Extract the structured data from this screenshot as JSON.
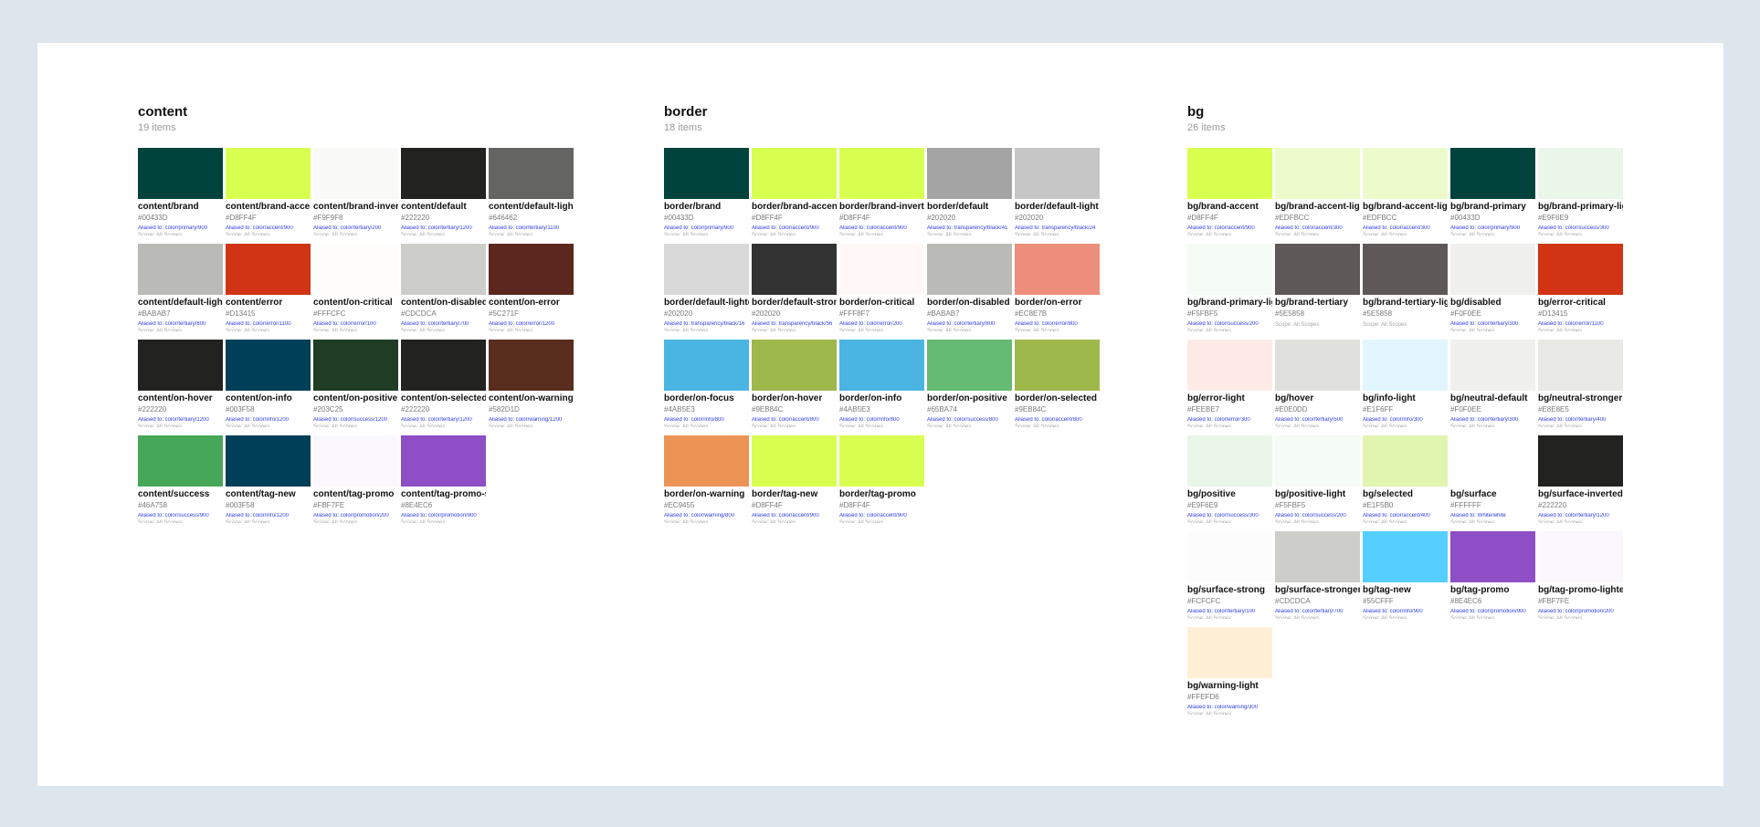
{
  "groups": [
    {
      "id": "content",
      "title": "content",
      "count": "19 items",
      "items": [
        {
          "name": "content/brand",
          "hex": "#00433D",
          "alias": "Aliased to: color/primary/900",
          "scope": "Scope: All Scopes",
          "color": "#00433D"
        },
        {
          "name": "content/brand-accent",
          "hex": "#D8FF4F",
          "alias": "Aliased to: color/accent/900",
          "scope": "Scope: All Scopes",
          "color": "#D8FF4F"
        },
        {
          "name": "content/brand-inverted",
          "hex": "#F9F9F8",
          "alias": "Aliased to: color/tertiary/200",
          "scope": "Scope: All Scopes",
          "color": "#F9F9F8"
        },
        {
          "name": "content/default",
          "hex": "#222220",
          "alias": "Aliased to: color/tertiary/1200",
          "scope": "Scope: All Scopes",
          "color": "#222220"
        },
        {
          "name": "content/default-light",
          "hex": "#646462",
          "alias": "Aliased to: color/tertiary/1100",
          "scope": "Scope: All Scopes",
          "color": "#646462"
        },
        {
          "name": "content/default-lighter",
          "hex": "#BABAB7",
          "alias": "Aliased to: color/tertiary/800",
          "scope": "Scope: All Scopes",
          "color": "#BABAB7"
        },
        {
          "name": "content/error",
          "hex": "#D13415",
          "alias": "Aliased to: color/error/1100",
          "scope": "Scope: All Scopes",
          "color": "#D13415"
        },
        {
          "name": "content/on-critical",
          "hex": "#FFFCFC",
          "alias": "Aliased to: color/error/100",
          "scope": "Scope: All Scopes",
          "color": "#FFFCFC"
        },
        {
          "name": "content/on-disabled",
          "hex": "#CDCDCA",
          "alias": "Aliased to: color/tertiary/700",
          "scope": "Scope: All Scopes",
          "color": "#CDCDCA"
        },
        {
          "name": "content/on-error",
          "hex": "#5C271F",
          "alias": "Aliased to: color/error/1200",
          "scope": "Scope: All Scopes",
          "color": "#5C271F"
        },
        {
          "name": "content/on-hover",
          "hex": "#222220",
          "alias": "Aliased to: color/tertiary/1200",
          "scope": "Scope: All Scopes",
          "color": "#222220"
        },
        {
          "name": "content/on-info",
          "hex": "#003F58",
          "alias": "Aliased to: color/info/1200",
          "scope": "Scope: All Scopes",
          "color": "#003F58"
        },
        {
          "name": "content/on-positive",
          "hex": "#203C25",
          "alias": "Aliased to: color/success/1200",
          "scope": "Scope: All Scopes",
          "color": "#203C25"
        },
        {
          "name": "content/on-selected",
          "hex": "#222220",
          "alias": "Aliased to: color/tertiary/1200",
          "scope": "Scope: All Scopes",
          "color": "#222220"
        },
        {
          "name": "content/on-warning",
          "hex": "#582D1D",
          "alias": "Aliased to: color/warning/1200",
          "scope": "Scope: All Scopes",
          "color": "#582D1D"
        },
        {
          "name": "content/success",
          "hex": "#46A758",
          "alias": "Aliased to: color/success/900",
          "scope": "Scope: All Scopes",
          "color": "#46A758"
        },
        {
          "name": "content/tag-new",
          "hex": "#003F58",
          "alias": "Aliased to: color/info/1200",
          "scope": "Scope: All Scopes",
          "color": "#003F58"
        },
        {
          "name": "content/tag-promo",
          "hex": "#FBF7FE",
          "alias": "Aliased to: color/promotion/200",
          "scope": "Scope: All Scopes",
          "color": "#FBF7FE"
        },
        {
          "name": "content/tag-promo-strong",
          "hex": "#8E4EC6",
          "alias": "Aliased to: color/promotion/900",
          "scope": "Scope: All Scopes",
          "color": "#8E4EC6"
        }
      ]
    },
    {
      "id": "border",
      "title": "border",
      "count": "18 items",
      "items": [
        {
          "name": "border/brand",
          "hex": "#00433D",
          "alias": "Aliased to: color/primary/900",
          "scope": "Scope: All Scopes",
          "color": "#00433D"
        },
        {
          "name": "border/brand-accent",
          "hex": "#D8FF4F",
          "alias": "Aliased to: color/accent/900",
          "scope": "Scope: All Scopes",
          "color": "#D8FF4F"
        },
        {
          "name": "border/brand-inverted",
          "hex": "#D8FF4F",
          "alias": "Aliased to: color/accent/900",
          "scope": "Scope: All Scopes",
          "color": "#D8FF4F"
        },
        {
          "name": "border/default",
          "hex": "#202020",
          "alias": "Aliased to: transparency/black/41",
          "scope": "Scope: All Scopes",
          "color": "#A4A4A4"
        },
        {
          "name": "border/default-light",
          "hex": "#202020",
          "alias": "Aliased to: transparency/black/24",
          "scope": "Scope: All Scopes",
          "color": "#C6C6C6"
        },
        {
          "name": "border/default-lighter",
          "hex": "#202020",
          "alias": "Aliased to: transparency/black/16",
          "scope": "Scope: All Scopes",
          "color": "#D9D9D9"
        },
        {
          "name": "border/default-strong",
          "hex": "#202020",
          "alias": "Aliased to: transparency/black/56",
          "scope": "Scope: All Scopes",
          "color": "#333333"
        },
        {
          "name": "border/on-critical",
          "hex": "#FFF8F7",
          "alias": "Aliased to: color/error/200",
          "scope": "Scope: All Scopes",
          "color": "#FFF8F7"
        },
        {
          "name": "border/on-disabled",
          "hex": "#BABAB7",
          "alias": "Aliased to: color/tertiary/800",
          "scope": "Scope: All Scopes",
          "color": "#BABAB7"
        },
        {
          "name": "border/on-error",
          "hex": "#EC8E7B",
          "alias": "Aliased to: color/error/800",
          "scope": "Scope: All Scopes",
          "color": "#EC8E7B"
        },
        {
          "name": "border/on-focus",
          "hex": "#4AB5E3",
          "alias": "Aliased to: color/info/800",
          "scope": "Scope: All Scopes",
          "color": "#4AB5E3"
        },
        {
          "name": "border/on-hover",
          "hex": "#9EB84C",
          "alias": "Aliased to: color/accent/800",
          "scope": "Scope: All Scopes",
          "color": "#9EB84C"
        },
        {
          "name": "border/on-info",
          "hex": "#4AB5E3",
          "alias": "Aliased to: color/info/800",
          "scope": "Scope: All Scopes",
          "color": "#4AB5E3"
        },
        {
          "name": "border/on-positive",
          "hex": "#65BA74",
          "alias": "Aliased to: color/success/800",
          "scope": "Scope: All Scopes",
          "color": "#65BA74"
        },
        {
          "name": "border/on-selected",
          "hex": "#9EB84C",
          "alias": "Aliased to: color/accent/800",
          "scope": "Scope: All Scopes",
          "color": "#9EB84C"
        },
        {
          "name": "border/on-warning",
          "hex": "#EC9455",
          "alias": "Aliased to: color/warning/800",
          "scope": "Scope: All Scopes",
          "color": "#EC9455"
        },
        {
          "name": "border/tag-new",
          "hex": "#D8FF4F",
          "alias": "Aliased to: color/accent/900",
          "scope": "Scope: All Scopes",
          "color": "#D8FF4F"
        },
        {
          "name": "border/tag-promo",
          "hex": "#D8FF4F",
          "alias": "Aliased to: color/accent/900",
          "scope": "Scope: All Scopes",
          "color": "#D8FF4F"
        }
      ]
    },
    {
      "id": "bg",
      "title": "bg",
      "count": "26 items",
      "items": [
        {
          "name": "bg/brand-accent",
          "hex": "#D8FF4F",
          "alias": "Aliased to: color/accent/900",
          "scope": "Scope: All Scopes",
          "color": "#D8FF4F"
        },
        {
          "name": "bg/brand-accent-light",
          "hex": "#EDFBCC",
          "alias": "Aliased to: color/accent/300",
          "scope": "Scope: All Scopes",
          "color": "#EDFBCC"
        },
        {
          "name": "bg/brand-accent-lighter",
          "hex": "#EDFBCC",
          "alias": "Aliased to: color/accent/300",
          "scope": "Scope: All Scopes",
          "color": "#EDFBCC"
        },
        {
          "name": "bg/brand-primary",
          "hex": "#00433D",
          "alias": "Aliased to: color/primary/900",
          "scope": "Scope: All Scopes",
          "color": "#00433D"
        },
        {
          "name": "bg/brand-primary-light",
          "hex": "#E9F6E9",
          "alias": "Aliased to: color/success/300",
          "scope": "Scope: All Scopes",
          "color": "#E9F6E9"
        },
        {
          "name": "bg/brand-primary-lighter",
          "hex": "#F5FBF5",
          "alias": "Aliased to: color/success/200",
          "scope": "Scope: All Scopes",
          "color": "#F5FBF5"
        },
        {
          "name": "bg/brand-tertiary",
          "hex": "#5E5858",
          "alias": "",
          "scope": "Scope: All Scopes",
          "color": "#5E5858"
        },
        {
          "name": "bg/brand-tertiary-light",
          "hex": "#5E5858",
          "alias": "",
          "scope": "Scope: All Scopes",
          "color": "#5E5858"
        },
        {
          "name": "bg/disabled",
          "hex": "#F0F0EE",
          "alias": "Aliased to: color/tertiary/300",
          "scope": "Scope: All Scopes",
          "color": "#F0F0EE"
        },
        {
          "name": "bg/error-critical",
          "hex": "#D13415",
          "alias": "Aliased to: color/error/1100",
          "scope": "Scope: All Scopes",
          "color": "#D13415"
        },
        {
          "name": "bg/error-light",
          "hex": "#FEEBE7",
          "alias": "Aliased to: color/error/300",
          "scope": "Scope: All Scopes",
          "color": "#FEEBE7"
        },
        {
          "name": "bg/hover",
          "hex": "#E0E0DD",
          "alias": "Aliased to: color/tertiary/500",
          "scope": "Scope: All Scopes",
          "color": "#E0E0DD"
        },
        {
          "name": "bg/info-light",
          "hex": "#E1F6FF",
          "alias": "Aliased to: color/info/300",
          "scope": "Scope: All Scopes",
          "color": "#E1F6FF"
        },
        {
          "name": "bg/neutral-default",
          "hex": "#F0F0EE",
          "alias": "Aliased to: color/tertiary/300",
          "scope": "Scope: All Scopes",
          "color": "#F0F0EE"
        },
        {
          "name": "bg/neutral-stronger",
          "hex": "#E8E8E5",
          "alias": "Aliased to: color/tertiary/400",
          "scope": "Scope: All Scopes",
          "color": "#E8E8E5"
        },
        {
          "name": "bg/positive",
          "hex": "#E9F6E9",
          "alias": "Aliased to: color/success/300",
          "scope": "Scope: All Scopes",
          "color": "#E9F6E9"
        },
        {
          "name": "bg/positive-light",
          "hex": "#F5FBF5",
          "alias": "Aliased to: color/success/200",
          "scope": "Scope: All Scopes",
          "color": "#F5FBF5"
        },
        {
          "name": "bg/selected",
          "hex": "#E1F5B0",
          "alias": "Aliased to: color/accent/400",
          "scope": "Scope: All Scopes",
          "color": "#E1F5B0"
        },
        {
          "name": "bg/surface",
          "hex": "#FFFFFF",
          "alias": "Aliased to: White/white",
          "scope": "Scope: All Scopes",
          "color": "#FFFFFF"
        },
        {
          "name": "bg/surface-inverted",
          "hex": "#222220",
          "alias": "Aliased to: color/tertiary/1200",
          "scope": "Scope: All Scopes",
          "color": "#222220"
        },
        {
          "name": "bg/surface-strong",
          "hex": "#FCFCFC",
          "alias": "Aliased to: color/tertiary/100",
          "scope": "Scope: All Scopes",
          "color": "#FCFCFC"
        },
        {
          "name": "bg/surface-stronger",
          "hex": "#CDCDCA",
          "alias": "Aliased to: color/tertiary/700",
          "scope": "Scope: All Scopes",
          "color": "#CDCDCA"
        },
        {
          "name": "bg/tag-new",
          "hex": "#55CFFF",
          "alias": "Aliased to: color/info/900",
          "scope": "Scope: All Scopes",
          "color": "#55CFFF"
        },
        {
          "name": "bg/tag-promo",
          "hex": "#8E4EC6",
          "alias": "Aliased to: color/promotion/900",
          "scope": "Scope: All Scopes",
          "color": "#8E4EC6"
        },
        {
          "name": "bg/tag-promo-lighter",
          "hex": "#FBF7FE",
          "alias": "Aliased to: color/promotion/200",
          "scope": "Scope: All Scopes",
          "color": "#FBF7FE"
        },
        {
          "name": "bg/warning-light",
          "hex": "#FFEFD6",
          "alias": "Aliased to: color/warning/300",
          "scope": "Scope: All Scopes",
          "color": "#FFEFD6"
        }
      ]
    }
  ]
}
